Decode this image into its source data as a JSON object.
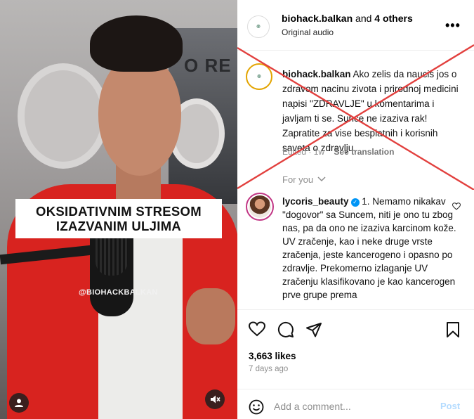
{
  "video": {
    "caption_line1": "OKSIDATIVNIM STRESOM",
    "caption_line2": "IZAZVANIM ULJIMA",
    "watermark": "@BIOHACKBALKAN",
    "background_text": "O RE",
    "user_icon": "user-icon",
    "mute_icon": "muted-speaker-icon"
  },
  "header": {
    "username": "biohack.balkan",
    "and_text": " and ",
    "others": "4 others",
    "subtitle": "Original audio",
    "more_icon": "more-horizontal-icon",
    "more_label": "•••"
  },
  "caption": {
    "username": "biohack.balkan",
    "text": " Ako zelis da naucis jos o zdravom nacinu zivota i prirodnoj medicini napisi \"ZDRAVLJE\" u komentarima i javljam ti se. Sunce ne izaziva rak! Zapratite za vise besplatnih i korisnih saveta o zdravlju.",
    "edited": "Edited",
    "dot": " · ",
    "age": "1w",
    "translate": "See translation",
    "for_you": "For you",
    "for_you_icon": "chevron-down-icon"
  },
  "comment": {
    "username": "lycoris_beauty",
    "verified_icon": "verified-badge-icon",
    "text": " 1. Nemamo nikakav \"dogovor\" sa Suncem, niti je ono tu zbog nas, pa da ono ne izaziva karcinom kože. UV zračenje, kao i neke druge vrste zračenja, jeste kancerogeno i opasno po zdravlje. Prekomerno izlaganje UV zračenju klasifikovano je kao kancerogen prve grupe prema",
    "like_icon": "heart-outline-icon"
  },
  "actions": {
    "likes": "3,663 likes",
    "ago": "7 days ago",
    "icons": [
      "heart-icon",
      "comment-icon",
      "share-icon",
      "bookmark-icon"
    ]
  },
  "add_comment": {
    "placeholder": "Add a comment...",
    "post": "Post",
    "emoji_icon": "emoji-icon"
  },
  "overlay": {
    "cross_color": "#e2403e"
  }
}
